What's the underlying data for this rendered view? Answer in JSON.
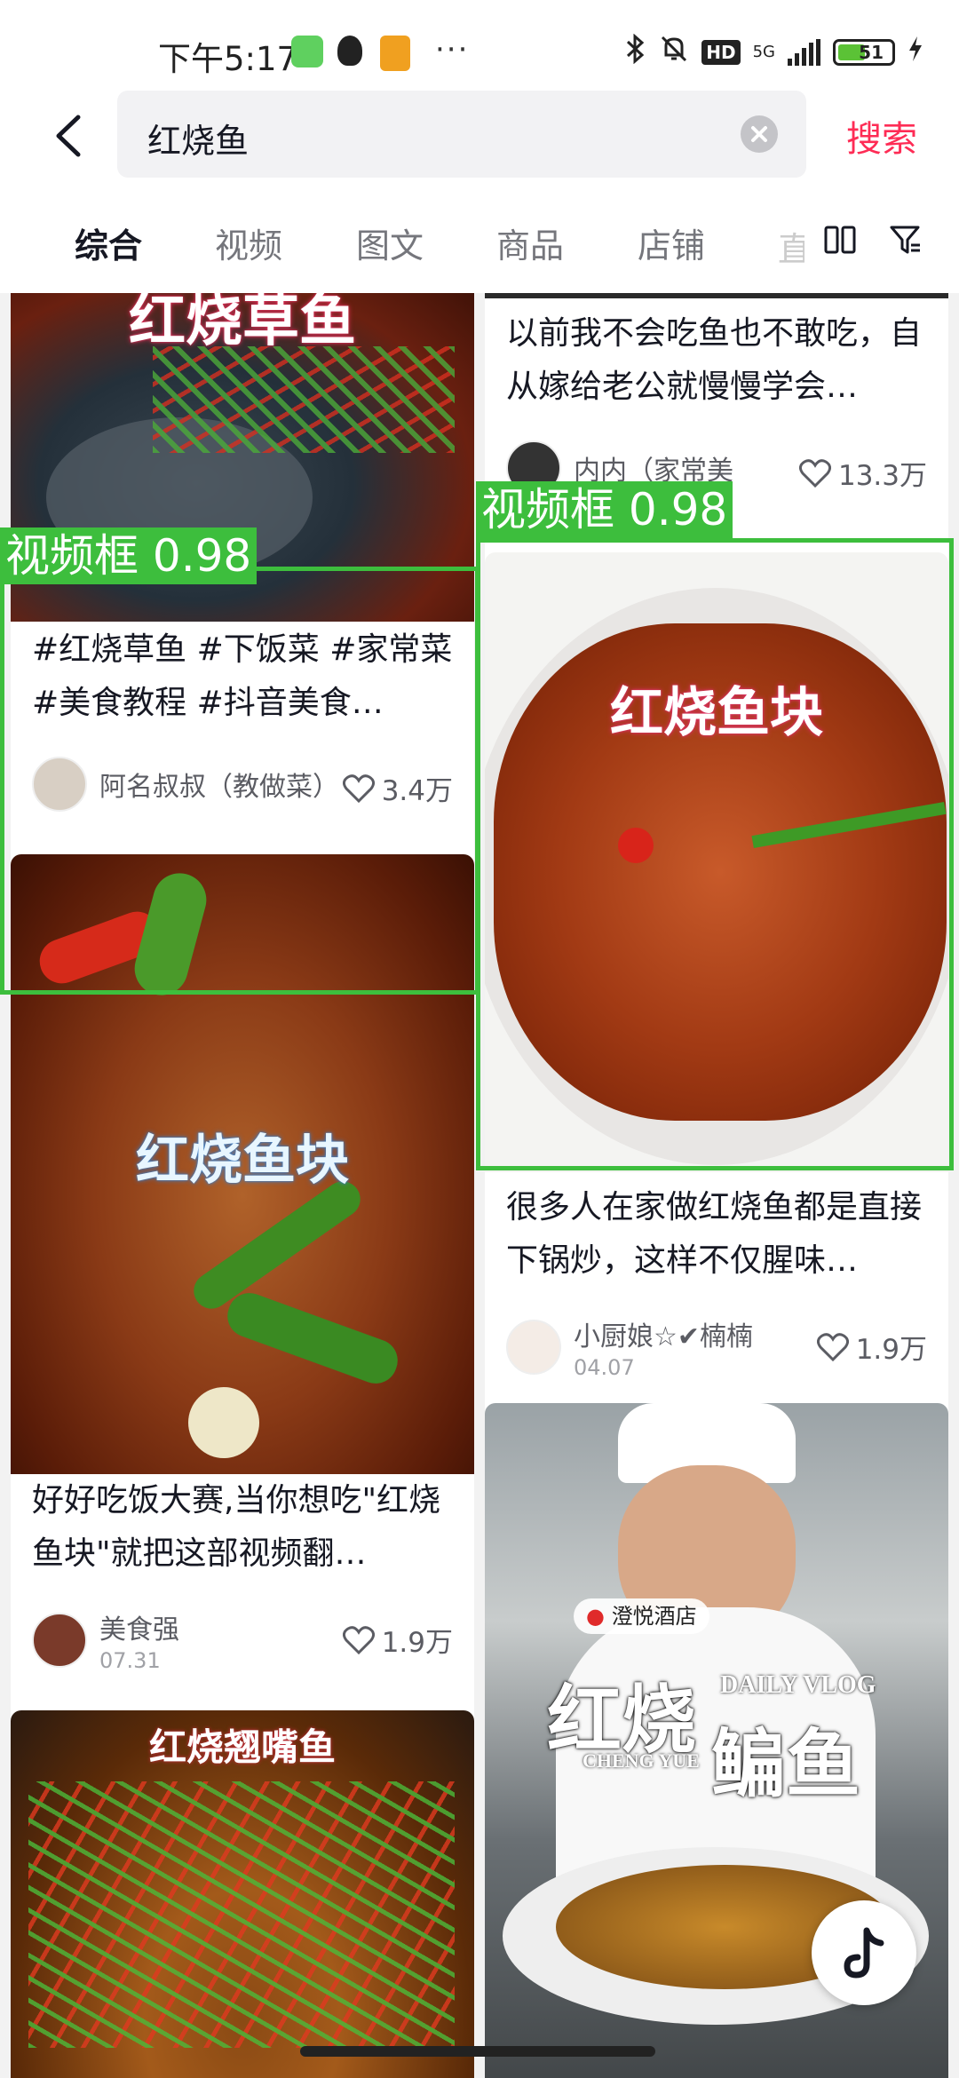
{
  "status_bar": {
    "time": "下午5:17",
    "dots": "···",
    "network": "5G",
    "hd": "HD",
    "battery": "51"
  },
  "search": {
    "query": "红烧鱼",
    "submit_label": "搜索"
  },
  "tabs": [
    {
      "label": "综合",
      "active": true
    },
    {
      "label": "视频",
      "active": false
    },
    {
      "label": "图文",
      "active": false
    },
    {
      "label": "商品",
      "active": false
    },
    {
      "label": "店铺",
      "active": false
    },
    {
      "label": "直",
      "active": false
    }
  ],
  "cards": [
    {
      "thumb_title": "红烧草鱼",
      "description": "#红烧草鱼 #下饭菜 #家常菜 #美食教程 #抖音美食…",
      "author": "阿名叔叔（教做菜）",
      "likes": "3.4万"
    },
    {
      "thumb_title": "红烧鱼块",
      "description": "好好吃饭大赛,当你想吃\"红烧鱼块\"就把这部视频翻…",
      "author": "美食强",
      "date": "07.31",
      "likes": "1.9万"
    },
    {
      "thumb_title": "红烧翘嘴鱼"
    },
    {
      "description": "以前我不会吃鱼也不敢吃，自从嫁给老公就慢慢学会…",
      "author": "内内（家常美",
      "likes": "13.3万"
    },
    {
      "thumb_title": "红烧鱼块",
      "description": "很多人在家做红烧鱼都是直接下锅炒，这样不仅腥味…",
      "author": "小厨娘☆✔楠楠",
      "date": "04.07",
      "likes": "1.9万"
    },
    {
      "thumb_title_big": "红烧",
      "thumb_title_big2": "鳊鱼",
      "vlog_tag": "DAILY VLOG",
      "brand": "CHENG YUE",
      "location": "澄悦酒店"
    }
  ],
  "detections": [
    {
      "label": "视频框 0.98"
    },
    {
      "label": "视频框 0.98"
    }
  ],
  "colors": {
    "accent": "#fe2c55",
    "detection": "#3dbe3d"
  }
}
